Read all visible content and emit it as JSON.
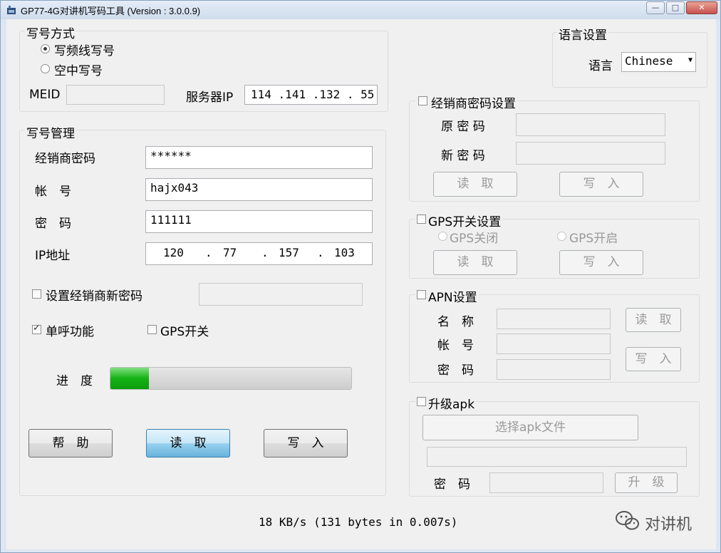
{
  "window": {
    "title": "GP77-4G对讲机写码工具 (Version : 3.0.0.9)",
    "controls": {
      "minimize": "—",
      "maximize": "□",
      "close": "✕"
    }
  },
  "write_mode": {
    "label": "写号方式",
    "option_cable": "写频线写号",
    "option_air": "空中写号",
    "selected": "写频线写号",
    "meid_label": "MEID",
    "meid_value": "",
    "server_ip_label": "服务器IP",
    "server_ip": [
      "114",
      ".141",
      ".132",
      ". 55"
    ]
  },
  "management": {
    "label": "写号管理",
    "dealer_password_label": "经销商密码",
    "dealer_password_value": "******",
    "account_label": "帐　号",
    "account_value": "hajx043",
    "password_label": "密　码",
    "password_value": "111111",
    "ip_label": "IP地址",
    "ip_octets": [
      "120",
      "77",
      "157",
      "103"
    ],
    "set_new_dealer_pw_label": "设置经销商新密码",
    "set_new_dealer_pw_checked": false,
    "single_call_label": "单呼功能",
    "single_call_checked": true,
    "gps_switch_label": "GPS开关",
    "gps_switch_checked": false,
    "progress_label": "进　度",
    "progress_fraction": 0.16,
    "help_button": "帮　助",
    "read_button": "读　取",
    "write_button": "写　入"
  },
  "language": {
    "group_label": "语言设置",
    "label": "语言",
    "selected": "Chinese"
  },
  "dealer_pw_settings": {
    "label": "经销商密码设置",
    "checked": false,
    "old_pw_label": "原 密 码",
    "new_pw_label": "新 密 码",
    "read_button": "读　取",
    "write_button": "写　入"
  },
  "gps_settings": {
    "label": "GPS开关设置",
    "checked": false,
    "off_label": "GPS关闭",
    "on_label": "GPS开启",
    "read_button": "读　取",
    "write_button": "写　入"
  },
  "apn_settings": {
    "label": "APN设置",
    "checked": false,
    "name_label": "名　称",
    "account_label": "帐　号",
    "password_label": "密　码",
    "read_button": "读　取",
    "write_button": "写　入"
  },
  "upgrade": {
    "label": "升级apk",
    "checked": false,
    "select_button": "选择apk文件",
    "password_label": "密　码",
    "upgrade_button": "升　级"
  },
  "status": {
    "transfer": "18 KB/s (131 bytes in 0.007s)"
  },
  "watermark": {
    "text": "对讲机",
    "icon": "wechat-icon"
  }
}
